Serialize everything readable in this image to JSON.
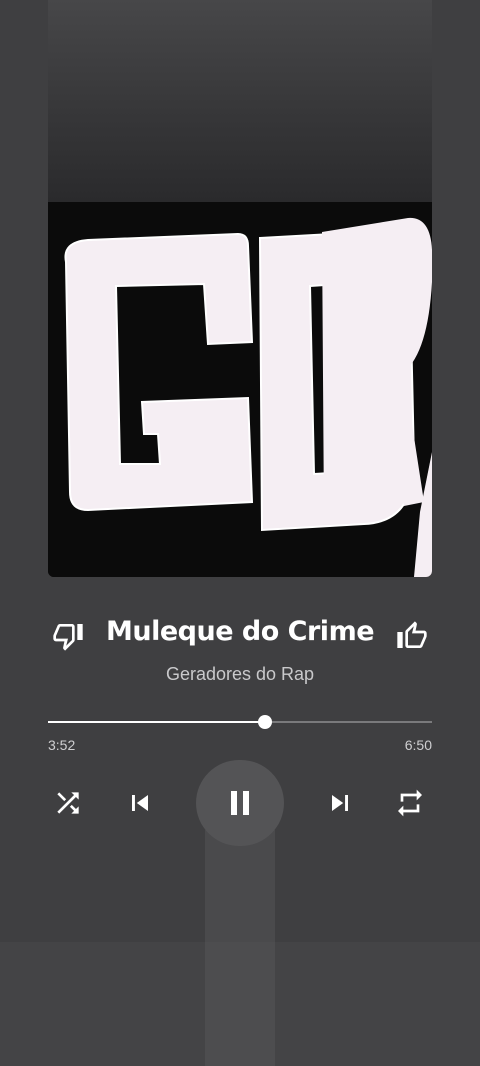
{
  "player": {
    "title": "Muleque do Crime",
    "artist": "Geradores do Rap",
    "time_current": "3:52",
    "time_total": "6:50",
    "progress_fraction": 0.566,
    "is_playing": true,
    "artwork_text": "GDR"
  },
  "icons": {
    "dislike": "thumbs-down-icon",
    "like": "thumbs-up-icon",
    "shuffle": "shuffle-icon",
    "previous": "skip-previous-icon",
    "pause": "pause-icon",
    "next": "skip-next-icon",
    "repeat": "repeat-icon"
  },
  "colors": {
    "background": "#3f3f41",
    "accent": "#ffffff",
    "secondary_text": "#c9c9cb",
    "track": "#7a7a7c",
    "play_button": "#545456"
  }
}
